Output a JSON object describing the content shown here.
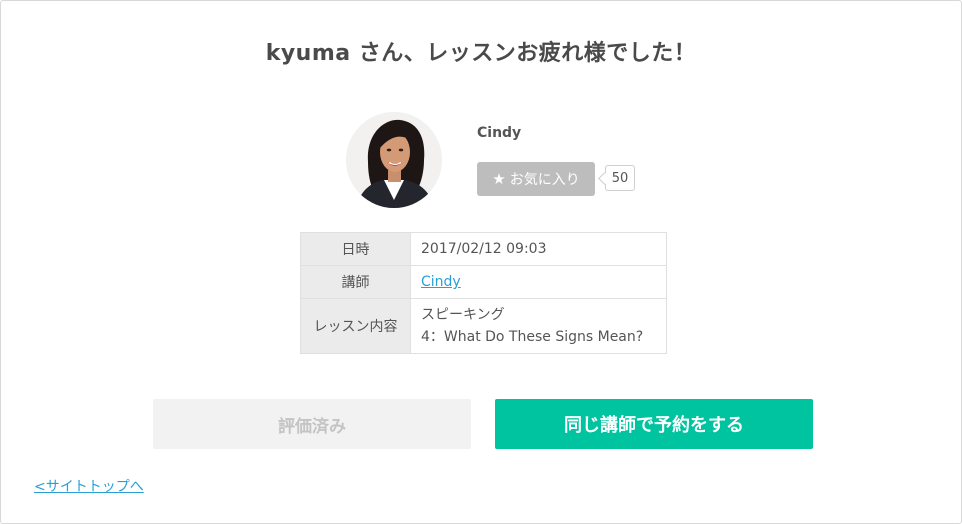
{
  "header": {
    "title": "kyuma さん、レッスンお疲れ様でした！"
  },
  "teacher": {
    "name": "Cindy",
    "favorite_label": "お気に入り",
    "favorite_count": "50"
  },
  "lesson_table": {
    "rows": [
      {
        "label": "日時",
        "value": "2017/02/12 09:03"
      },
      {
        "label": "講師",
        "value": "Cindy"
      },
      {
        "label": "レッスン内容",
        "value_line1": "スピーキング",
        "value_line2": "4：What Do These Signs Mean?"
      }
    ]
  },
  "actions": {
    "rated_label": "評価済み",
    "book_label": "同じ講師で予約をする"
  },
  "footer": {
    "back_link": "<サイトトップへ"
  },
  "colors": {
    "accent": "#00c4a0",
    "link": "#2a9fd6",
    "disabled_bg": "#f2f2f2",
    "fav_bg": "#bdbdbd"
  },
  "icons": {
    "favorite": "star-icon"
  }
}
